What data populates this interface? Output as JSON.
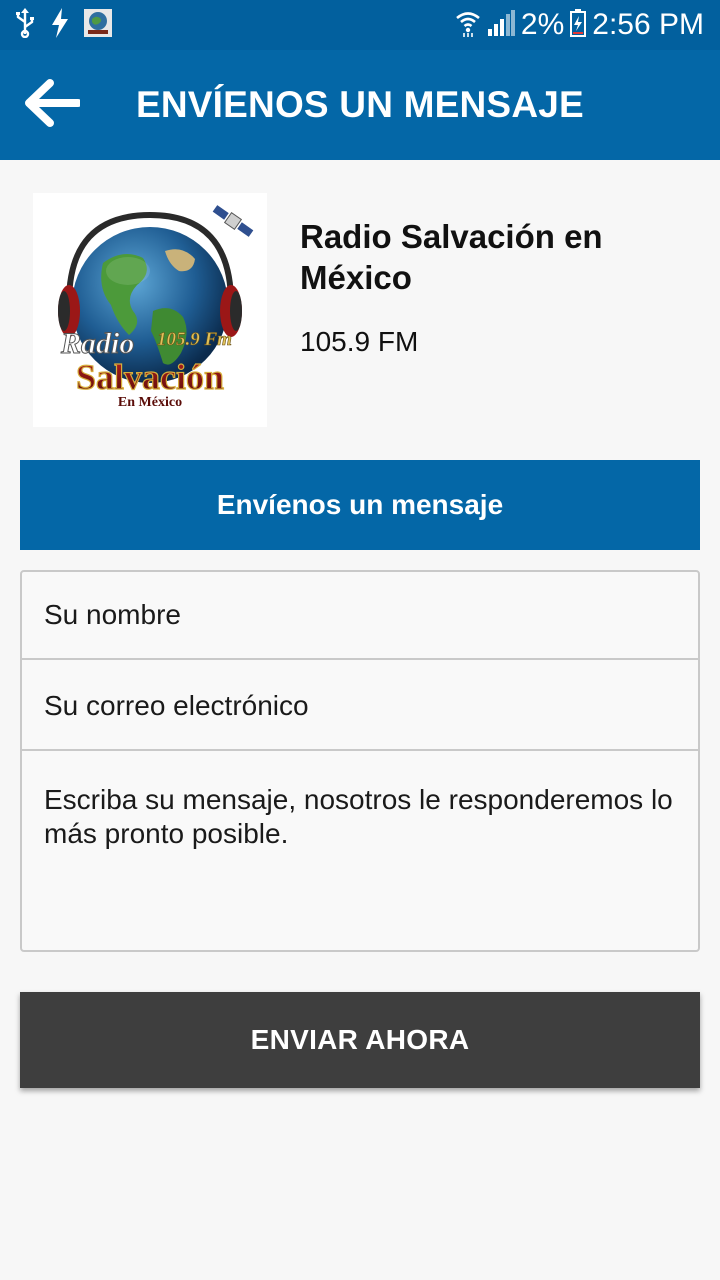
{
  "status_bar": {
    "time": "2:56 PM",
    "battery_percent": "2%",
    "icons": [
      "usb-icon",
      "charging-bolt-icon",
      "app-notification-icon",
      "wifi-icon",
      "signal-icon",
      "battery-icon"
    ]
  },
  "app_bar": {
    "title": "ENVÍENOS UN MENSAJE",
    "back_icon": "arrow-left-icon"
  },
  "station": {
    "name": "Radio Salvación en México",
    "frequency": "105.9 FM",
    "logo": {
      "word_top": "Radio",
      "freq": "105.9 Fm",
      "word_main": "Salvación",
      "word_sub": "En México"
    }
  },
  "contact_form": {
    "header": "Envíenos un mensaje",
    "name_placeholder": "Su nombre",
    "email_placeholder": "Su correo electrónico",
    "message_placeholder": "Escriba su mensaje, nosotros le responderemos lo más pronto posible.",
    "submit_label": "ENVIAR AHORA"
  },
  "colors": {
    "primary": "#0467a7",
    "status_bar": "#02609e",
    "button": "#3e3e3e",
    "background": "#f7f7f7"
  }
}
